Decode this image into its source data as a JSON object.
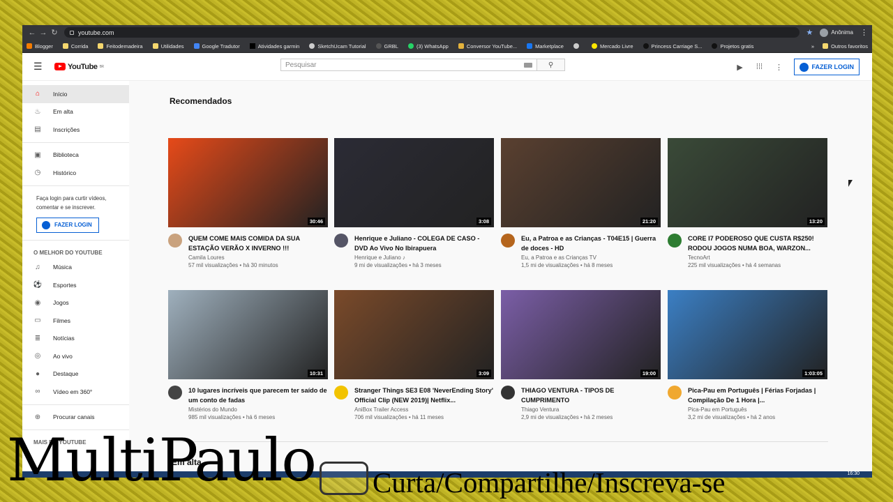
{
  "browser": {
    "url": "youtube.com",
    "profile_label": "Anônima",
    "bookmarks": [
      "Blogger",
      "Corrida",
      "Feitodemadeira",
      "Utilidades",
      "Google Tradutor",
      "Atividades garmin",
      "SketchUcam Tutorial",
      "GRBL",
      "(3) WhatsApp",
      "Conversor YouTube...",
      "Marketplace",
      "",
      "Mercado Livre",
      "Princess Carriage S...",
      "Projetos gratis"
    ],
    "other_bookmarks": "Outros favoritos"
  },
  "masthead": {
    "logo": "YouTube",
    "region": "BR",
    "search_placeholder": "Pesquisar",
    "login_label": "FAZER LOGIN"
  },
  "sidebar": {
    "primary": [
      {
        "label": "Início",
        "icon": "home-icon"
      },
      {
        "label": "Em alta",
        "icon": "fire-icon"
      },
      {
        "label": "Inscrições",
        "icon": "subscriptions-icon"
      }
    ],
    "library": [
      {
        "label": "Biblioteca",
        "icon": "library-icon"
      },
      {
        "label": "Histórico",
        "icon": "history-icon"
      }
    ],
    "login_text": "Faça login para curtir vídeos, comentar e se inscrever.",
    "login_label": "FAZER LOGIN",
    "best_heading": "O MELHOR DO YOUTUBE",
    "best": [
      {
        "label": "Música"
      },
      {
        "label": "Esportes"
      },
      {
        "label": "Jogos"
      },
      {
        "label": "Filmes"
      },
      {
        "label": "Notícias"
      },
      {
        "label": "Ao vivo"
      },
      {
        "label": "Destaque"
      },
      {
        "label": "Vídeo em 360°"
      }
    ],
    "browse_channels": "Procurar canais",
    "more_heading": "MAIS DO YOUTUBE"
  },
  "main": {
    "recommended_title": "Recomendados",
    "trending_title": "Em alta",
    "videos": [
      {
        "title": "QUEM COME MAIS COMIDA DA SUA ESTAÇÃO VERÃO X INVERNO !!!",
        "channel": "Camila Loures",
        "stats": "57 mil visualizações • há 30 minutos",
        "duration": "30:46",
        "thumb_color": "#e64a19",
        "avatar_color": "#c9a27e"
      },
      {
        "title": "Henrique e Juliano - COLEGA DE CASO - DVD Ao Vivo No Ibirapuera",
        "channel": "Henrique e Juliano ♪",
        "stats": "9 mi de visualizações • há 3 meses",
        "duration": "3:08",
        "thumb_color": "#2b2b35",
        "avatar_color": "#556"
      },
      {
        "title": "Eu, a Patroa e as Crianças - T04E15 | Guerra de doces - HD",
        "channel": "Eu, a Patroa e as Crianças TV",
        "stats": "1,5 mi de visualizações • há 8 meses",
        "duration": "21:20",
        "thumb_color": "#5a4030",
        "avatar_color": "#b5651d"
      },
      {
        "title": "CORE I7 PODEROSO QUE CUSTA R$250! RODOU JOGOS NUMA BOA, WARZON...",
        "channel": "TecnoArt",
        "stats": "225 mil visualizações • há 4 semanas",
        "duration": "13:20",
        "thumb_color": "#3a4a38",
        "avatar_color": "#2e7d32"
      },
      {
        "title": "10 lugares incríveis que parecem ter saído de um conto de fadas",
        "channel": "Mistérios do Mundo",
        "stats": "985 mil visualizações • há 6 meses",
        "duration": "10:31",
        "thumb_color": "#9fb0bd",
        "avatar_color": "#444"
      },
      {
        "title": "Stranger Things SE3 E08 'NeverEnding Story' Official Clip (NEW 2019)| Netflix...",
        "channel": "AniBox Trailer Access",
        "stats": "706 mil visualizações • há 11 meses",
        "duration": "3:09",
        "thumb_color": "#7a4a2a",
        "avatar_color": "#f2c300"
      },
      {
        "title": "THIAGO VENTURA - TIPOS DE CUMPRIMENTO",
        "channel": "Thiago Ventura",
        "stats": "2,9 mi de visualizações • há 2 meses",
        "duration": "19:00",
        "thumb_color": "#7b5ea7",
        "avatar_color": "#333"
      },
      {
        "title": "Pica-Pau em Português | Férias Forjadas | Compilação De 1 Hora |...",
        "channel": "Pica-Pau em Português",
        "stats": "3,2 mi de visualizações • há 2 anos",
        "duration": "1:03:05",
        "thumb_color": "#3b7fc4",
        "avatar_color": "#f0a830"
      }
    ]
  },
  "taskbar": {
    "clock": "16:30"
  },
  "overlay": {
    "brand": "MultiPaulo",
    "cta": "Curta/Compartilhe/Inscreva-se"
  }
}
